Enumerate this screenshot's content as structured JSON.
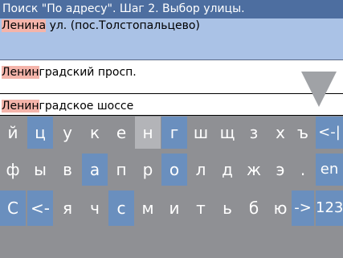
{
  "title": "Поиск \"По адресу\". Шаг 2. Выбор улицы.",
  "results": [
    {
      "match": "Ленина",
      "rest": " ул. (пос.Толстопальцево)"
    },
    {
      "match": "Ленин",
      "rest": "градский просп."
    },
    {
      "match": "Ленин",
      "rest": "градское шоссе"
    }
  ],
  "keyboard": {
    "row1": [
      "й",
      "ц",
      "у",
      "к",
      "е",
      "н",
      "г",
      "ш",
      "щ",
      "з",
      "х",
      "ъ",
      "<-|"
    ],
    "row2": [
      "ф",
      "ы",
      "в",
      "а",
      "п",
      "р",
      "о",
      "л",
      "д",
      "ж",
      "э",
      ".",
      "en"
    ],
    "row3": [
      "С",
      "<-",
      "я",
      "ч",
      "с",
      "м",
      "и",
      "т",
      "ь",
      "б",
      "ю",
      "->",
      "123"
    ]
  },
  "colors": {
    "title_bg": "#4d6ea0",
    "selected_row": "#aac2e6",
    "match_highlight": "#f4b4aa",
    "key_gray": "#8f9094",
    "key_blue": "#6a8fbe",
    "key_light": "#b3b4b8"
  }
}
